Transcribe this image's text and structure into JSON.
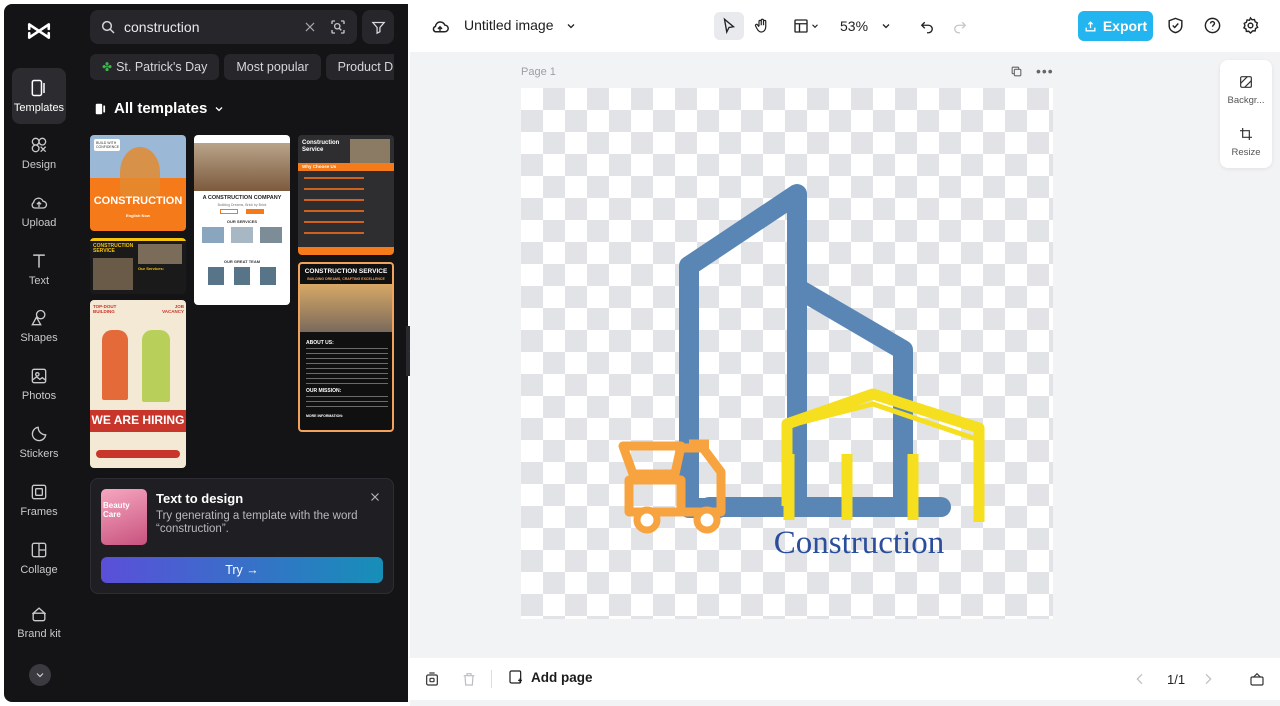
{
  "rail": {
    "items": [
      {
        "label": "Templates",
        "icon": "templates-icon",
        "active": true
      },
      {
        "label": "Design",
        "icon": "design-icon"
      },
      {
        "label": "Upload",
        "icon": "upload-cloud-icon"
      },
      {
        "label": "Text",
        "icon": "text-icon"
      },
      {
        "label": "Shapes",
        "icon": "shapes-icon"
      },
      {
        "label": "Photos",
        "icon": "photos-icon"
      },
      {
        "label": "Stickers",
        "icon": "stickers-icon"
      },
      {
        "label": "Frames",
        "icon": "frames-icon"
      },
      {
        "label": "Collage",
        "icon": "collage-icon"
      },
      {
        "label": "Brand kit",
        "icon": "brand-kit-icon"
      }
    ]
  },
  "panel": {
    "search_value": "construction",
    "chips": [
      "St. Patrick's Day",
      "Most popular",
      "Product Dis"
    ],
    "section_title": "All templates",
    "thumbs": {
      "t1_title": "CONSTRUCTION",
      "t1_badge": "BUILD WITH CONFIDENCE",
      "t1_sub": "English Now",
      "t2_title": "CONSTRUCTION SERVICE",
      "t2_sub": "Our Services:",
      "t3_top1": "TOP-DOUT",
      "t3_top2": "BUILDING",
      "t3_vac": "JOB VACANCY",
      "t3_title": "WE ARE HIRING",
      "t4_title": "A CONSTRUCTION COMPANY",
      "t4_sub": "Building Dreams, Brick by Brick",
      "t4_services": "OUR SERVICES",
      "t4_team": "OUR GREAT TEAM",
      "t5_title": "Construction Service",
      "t5_why": "Why Choose Us",
      "t6_title": "CONSTRUCTION SERVICE",
      "t6_sub": "BUILDING DREAMS, CRAFTING EXCELLENCE",
      "t6_about": "ABOUT US:",
      "t6_mission": "OUR MISSION:",
      "t6_more": "MORE INFORMATION:"
    },
    "ttd": {
      "thumb_text": "Beauty Care",
      "title": "Text to design",
      "desc": "Try generating a template with the word “construction”.",
      "button": "Try →"
    }
  },
  "topbar": {
    "doc_title": "Untitled image",
    "zoom": "53%",
    "export_label": "Export"
  },
  "canvas": {
    "page_label": "Page 1",
    "logo_text": "Construction",
    "colors": {
      "building": "#5a86b6",
      "truck": "#f7a440",
      "frame": "#f5df1e",
      "text": "#2a4d9c"
    }
  },
  "side_tools": {
    "background": "Backgr...",
    "resize": "Resize"
  },
  "bottombar": {
    "add_page": "Add page",
    "pager": "1/1"
  }
}
